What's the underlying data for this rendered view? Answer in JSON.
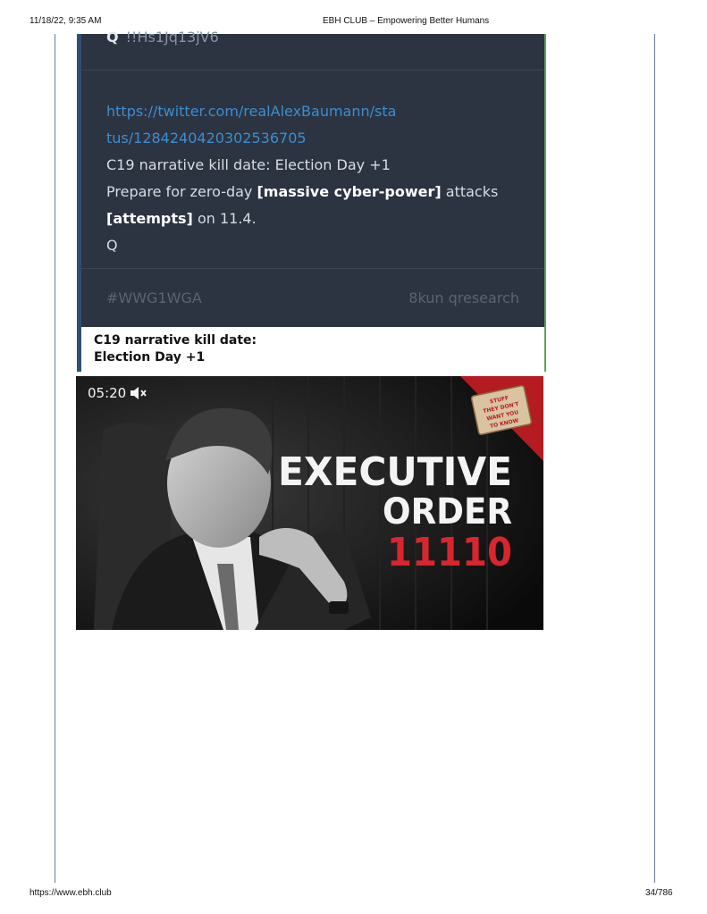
{
  "print": {
    "datetime": "11/18/22, 9:35 AM",
    "title": "EBH CLUB – Empowering Better Humans",
    "url": "https://www.ebh.club",
    "page": "34/786"
  },
  "post": {
    "q_label": "Q",
    "tripcode": "!!Hs1Jq13jV6",
    "link_line1": "https://twitter.com/realAlexBaumann/sta",
    "link_line2": "tus/1284240420302536705",
    "line1": "C19 narrative kill date: Election Day +1",
    "line2_pre": "Prepare for zero-day ",
    "line2_bold": "[massive cyber-power]",
    "line2_post": " attacks",
    "line3_bold": "[attempts]",
    "line3_post": " on 11.4.",
    "line4": "Q",
    "hashtag": "#WWG1WGA",
    "source": "8kun qresearch"
  },
  "caption": {
    "line1": "C19 narrative kill date:",
    "line2": "Election Day +1"
  },
  "video": {
    "time": "05:20",
    "title_line1": "EXECUTIVE",
    "title_line2": "ORDER",
    "title_line3": "11110",
    "badge_lines": [
      "STUFF",
      "THEY DON'T",
      "WANT YOU",
      "TO KNOW"
    ],
    "colors": {
      "number": "#d8262e",
      "corner": "#b51c22",
      "text": "#f4f4f4"
    }
  }
}
